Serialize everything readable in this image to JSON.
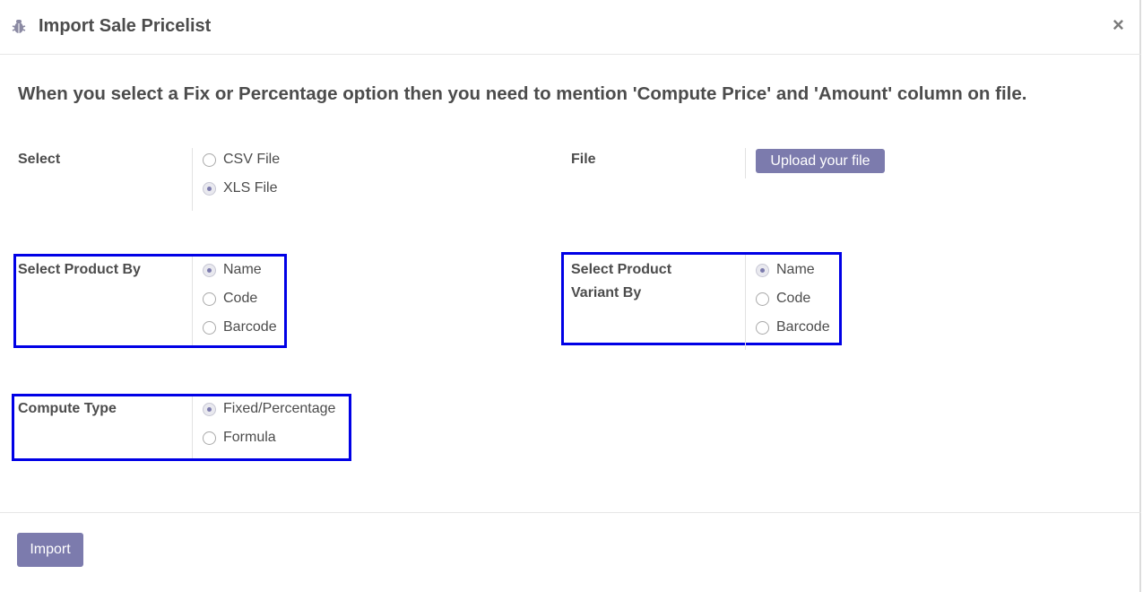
{
  "dialog": {
    "title": "Import Sale Pricelist",
    "close_label": "×"
  },
  "notice": "When you select a Fix or Percentage option then you need to mention 'Compute Price' and 'Amount' column on file.",
  "select": {
    "label": "Select",
    "options": [
      "CSV File",
      "XLS File"
    ],
    "selected": "XLS File"
  },
  "file": {
    "label": "File",
    "button_label": "Upload your file"
  },
  "product_by": {
    "label": "Select Product By",
    "options": [
      "Name",
      "Code",
      "Barcode"
    ],
    "selected": "Name"
  },
  "variant_by": {
    "label_line1": "Select Product",
    "label_line2": "Variant By",
    "options": [
      "Name",
      "Code",
      "Barcode"
    ],
    "selected": "Name"
  },
  "compute_type": {
    "label": "Compute Type",
    "options": [
      "Fixed/Percentage",
      "Formula"
    ],
    "selected": "Fixed/Percentage"
  },
  "footer": {
    "import_label": "Import"
  },
  "colors": {
    "accent": "#7c7bad",
    "highlight": "#0000e6"
  }
}
